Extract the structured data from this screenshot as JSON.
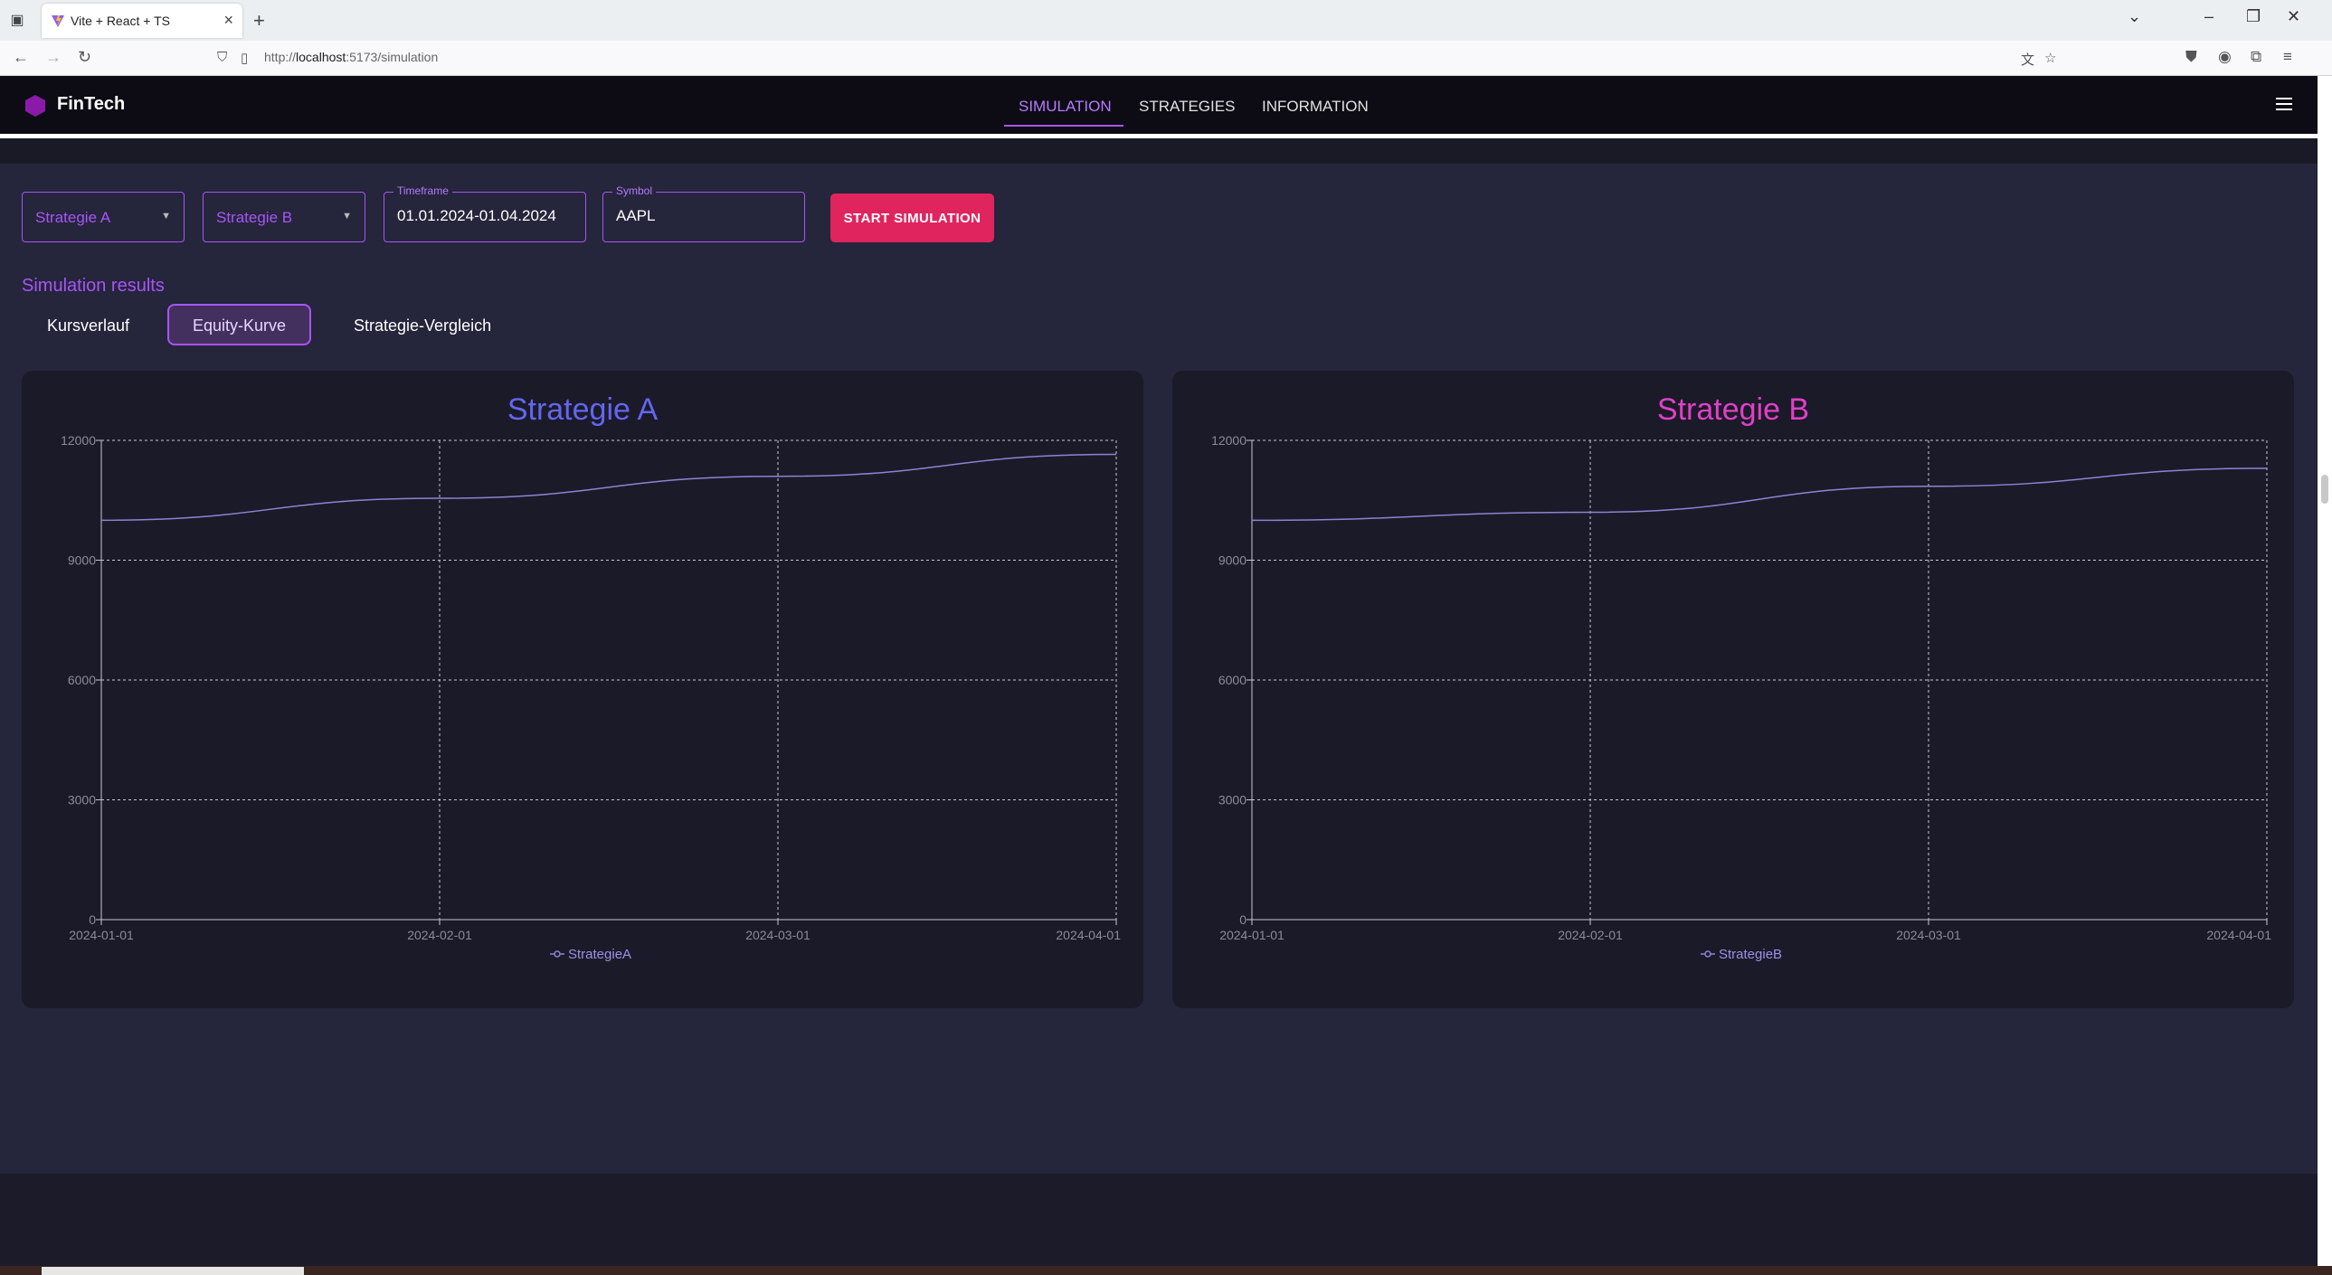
{
  "browser": {
    "tab_title": "Vite + React + TS",
    "url_prefix": "http://",
    "url_host": "localhost",
    "url_path": ":5173/simulation"
  },
  "header": {
    "brand": "FinTech",
    "nav": [
      "SIMULATION",
      "STRATEGIES",
      "INFORMATION"
    ],
    "active_nav": "SIMULATION"
  },
  "controls": {
    "strategy_a": "Strategie A",
    "strategy_b": "Strategie B",
    "timeframe_label": "Timeframe",
    "timeframe_value": "01.01.2024-01.04.2024",
    "symbol_label": "Symbol",
    "symbol_value": "AAPL",
    "start_button": "START SIMULATION"
  },
  "results": {
    "title": "Simulation results",
    "tabs": [
      "Kursverlauf",
      "Equity-Kurve",
      "Strategie-Vergleich"
    ],
    "active_tab": "Equity-Kurve"
  },
  "colors": {
    "accent": "#a855f7",
    "start_button": "#e0245e",
    "chart_a_title": "#6366f1",
    "chart_b_title": "#e040c8",
    "line": "#8b84d7"
  },
  "chart_data": [
    {
      "type": "line",
      "title": "Strategie A",
      "x": [
        "2024-01-01",
        "2024-02-01",
        "2024-03-01",
        "2024-04-01"
      ],
      "series": [
        {
          "name": "StrategieA",
          "values": [
            10000,
            10550,
            11100,
            11650
          ]
        }
      ],
      "ylim": [
        0,
        12000
      ],
      "yticks": [
        0,
        3000,
        6000,
        9000,
        12000
      ],
      "grid": true,
      "legend": "bottom-center"
    },
    {
      "type": "line",
      "title": "Strategie B",
      "x": [
        "2024-01-01",
        "2024-02-01",
        "2024-03-01",
        "2024-04-01"
      ],
      "series": [
        {
          "name": "StrategieB",
          "values": [
            10000,
            10200,
            10850,
            11300
          ]
        }
      ],
      "ylim": [
        0,
        12000
      ],
      "yticks": [
        0,
        3000,
        6000,
        9000,
        12000
      ],
      "grid": true,
      "legend": "bottom-center"
    }
  ]
}
